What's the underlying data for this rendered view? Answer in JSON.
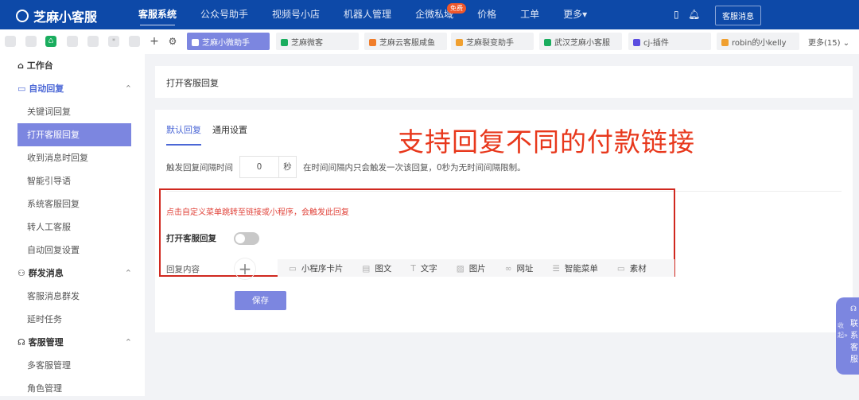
{
  "header": {
    "logo": "芝麻小客服",
    "nav": [
      "客服系统",
      "公众号助手",
      "视频号小店",
      "机器人管理",
      "企微私域",
      "价格",
      "工单",
      "更多▾"
    ],
    "badge": "免费",
    "service_msg": "客服消息"
  },
  "tabbar": {
    "tabs": [
      {
        "label": "芝麻小微助手",
        "color": "#ffffff"
      },
      {
        "label": "芝麻微客",
        "color": "#1aad5e"
      },
      {
        "label": "芝麻云客服咸鱼",
        "color": "#f07d2a"
      },
      {
        "label": "芝麻裂变助手",
        "color": "#f0a030"
      },
      {
        "label": "武汉芝麻小客服",
        "color": "#1aad5e"
      },
      {
        "label": "cj-插件",
        "color": "#5b4de0"
      },
      {
        "label": "robin的小kelly",
        "color": "#f0a030"
      }
    ],
    "more": "更多(15) ⌄"
  },
  "sidebar": {
    "workbench": "工作台",
    "auto_reply": "自动回复",
    "auto_items": [
      "关键词回复",
      "打开客服回复",
      "收到消息时回复",
      "智能引导语",
      "系统客服回复",
      "转人工客服",
      "自动回复设置"
    ],
    "mass": "群发消息",
    "mass_items": [
      "客服消息群发",
      "延时任务"
    ],
    "service": "客服管理",
    "service_items": [
      "多客服管理",
      "角色管理"
    ]
  },
  "main": {
    "title": "打开客服回复",
    "tabs": [
      "默认回复",
      "通用设置"
    ],
    "annotation": "支持回复不同的付款链接",
    "interval_label": "触发回复间隔时间",
    "interval_value": "0",
    "interval_unit": "秒",
    "interval_hint": "在时间间隔内只会触发一次该回复，0秒为无时间间隔限制。",
    "tip": "点击自定义菜单跳转至链接或小程序，会触发此回复",
    "toggle_label": "打开客服回复",
    "toggle_on": false,
    "content_label": "回复内容",
    "tools": [
      "小程序卡片",
      "图文",
      "文字",
      "图片",
      "网址",
      "智能菜单",
      "素材"
    ],
    "save": "保存"
  },
  "float": {
    "collapse": "收起»",
    "contact": "联系客服"
  }
}
